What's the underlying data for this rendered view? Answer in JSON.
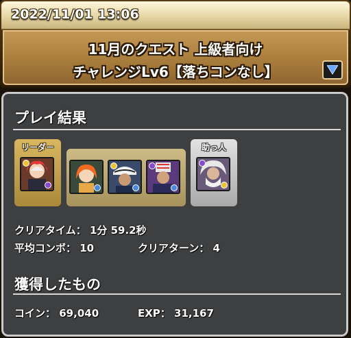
{
  "header": {
    "datetime": "2022/11/01 13:06",
    "quest_title_line1": "11月のクエスト 上級者向け",
    "quest_title_line2": "チャレンジLv6【落ちコンなし】"
  },
  "results": {
    "section_title": "プレイ結果",
    "leader_tag": "リーダー",
    "helper_tag": "助っ人",
    "team": [
      {
        "icon": "red-haired-girl-portrait",
        "frame_color": "#8a5a2a"
      },
      {
        "icon": "orange-haired-woman-portrait",
        "frame_color": "#3a5a3a"
      },
      {
        "icon": "white-hat-swordsman-portrait",
        "frame_color": "#3a4a6a"
      },
      {
        "icon": "striped-hat-man-portrait",
        "frame_color": "#5a3a6a"
      },
      {
        "icon": "white-haired-old-man-portrait",
        "frame_color": "#6a5a7a"
      }
    ],
    "clear_time_label": "クリアタイム：",
    "clear_time_value": "1分 59.2秒",
    "avg_combo_label": "平均コンボ：",
    "avg_combo_value": "10",
    "clear_turn_label": "クリアターン：",
    "clear_turn_value": "4"
  },
  "rewards": {
    "section_title": "獲得したもの",
    "coin_label": "コイン：",
    "coin_value": "69,040",
    "exp_label": "EXP：",
    "exp_value": "31,167"
  }
}
